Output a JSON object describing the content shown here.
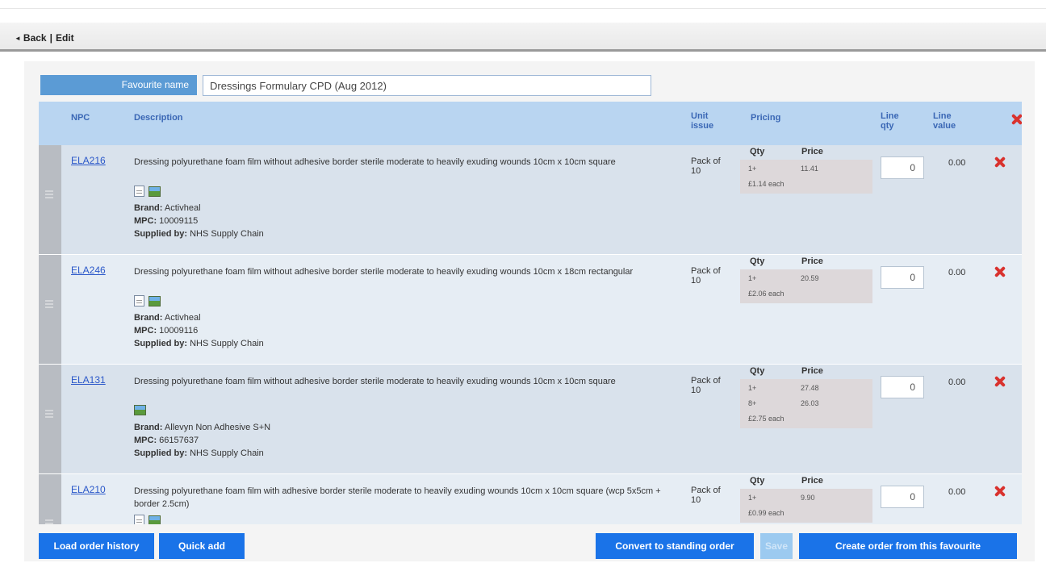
{
  "nav": {
    "back_label": "Back",
    "separator": "|",
    "edit_label": "Edit"
  },
  "favourite": {
    "label": "Favourite name",
    "value": "Dressings Formulary CPD (Aug 2012)"
  },
  "table": {
    "headers": {
      "npc": "NPC",
      "description": "Description",
      "unit_issue": "Unit issue",
      "pricing": "Pricing",
      "line_qty": "Line qty",
      "line_value": "Line value"
    },
    "pricing_headers": {
      "qty": "Qty",
      "price": "Price"
    },
    "rows": [
      {
        "npc": "ELA216",
        "description": "Dressing polyurethane foam film without adhesive border sterile moderate to heavily exuding wounds 10cm x 10cm square",
        "brand_label": "Brand:",
        "brand": "Activheal",
        "mpc_label": "MPC:",
        "mpc": "10009115",
        "supplier_label": "Supplied by:",
        "supplier": "NHS Supply Chain",
        "unit_issue": "Pack of 10",
        "prices": [
          {
            "qty": "1+",
            "price": "11.41"
          }
        ],
        "each": "£1.14 each",
        "line_qty": "0",
        "line_value": "0.00",
        "icons": [
          "document-icon",
          "image-icon"
        ]
      },
      {
        "npc": "ELA246",
        "description": "Dressing polyurethane foam film without adhesive border sterile moderate to heavily exuding wounds 10cm x 18cm rectangular",
        "brand_label": "Brand:",
        "brand": "Activheal",
        "mpc_label": "MPC:",
        "mpc": "10009116",
        "supplier_label": "Supplied by:",
        "supplier": "NHS Supply Chain",
        "unit_issue": "Pack of 10",
        "prices": [
          {
            "qty": "1+",
            "price": "20.59"
          }
        ],
        "each": "£2.06 each",
        "line_qty": "0",
        "line_value": "0.00",
        "icons": [
          "document-icon",
          "image-icon"
        ]
      },
      {
        "npc": "ELA131",
        "description": "Dressing polyurethane foam film without adhesive border sterile moderate to heavily exuding wounds 10cm x 10cm square",
        "brand_label": "Brand:",
        "brand": "Allevyn Non Adhesive S+N",
        "mpc_label": "MPC:",
        "mpc": "66157637",
        "supplier_label": "Supplied by:",
        "supplier": "NHS Supply Chain",
        "unit_issue": "Pack of 10",
        "prices": [
          {
            "qty": "1+",
            "price": "27.48"
          },
          {
            "qty": "8+",
            "price": "26.03"
          }
        ],
        "each": "£2.75 each",
        "line_qty": "0",
        "line_value": "0.00",
        "icons": [
          "image-icon"
        ]
      },
      {
        "npc": "ELA210",
        "description": "Dressing polyurethane foam film with adhesive border sterile moderate to heavily exuding wounds 10cm x 10cm square (wcp 5x5cm + border 2.5cm)",
        "brand_label": "",
        "brand": "",
        "mpc_label": "",
        "mpc": "",
        "supplier_label": "",
        "supplier": "",
        "unit_issue": "Pack of 10",
        "prices": [
          {
            "qty": "1+",
            "price": "9.90"
          }
        ],
        "each": "£0.99 each",
        "line_qty": "0",
        "line_value": "0.00",
        "icons": [
          "document-icon",
          "image-icon"
        ]
      }
    ]
  },
  "buttons": {
    "load_history": "Load order history",
    "quick_add": "Quick add",
    "convert_standing": "Convert to standing order",
    "save": "Save",
    "create_order": "Create order from this favourite"
  },
  "colors": {
    "accent": "#1a73e8",
    "header_bg": "#b9d5f1",
    "header_text": "#3a67b5",
    "delete": "#d9322e"
  }
}
